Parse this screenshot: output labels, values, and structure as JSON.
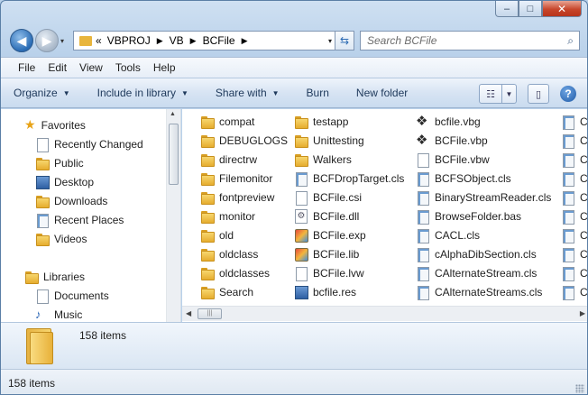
{
  "window": {
    "caption": {
      "minimize": "–",
      "maximize": "□",
      "close": "✕"
    }
  },
  "nav": {
    "back_icon": "◀",
    "forward_icon": "▶",
    "dropdown_icon": "▾",
    "address": {
      "overflow": "«",
      "crumbs": [
        "VBPROJ",
        "VB",
        "BCFile"
      ],
      "separator": "▶"
    },
    "refresh_icon": "⇆",
    "search": {
      "placeholder": "Search BCFile",
      "icon": "search-icon"
    }
  },
  "menu": {
    "items": [
      "File",
      "Edit",
      "View",
      "Tools",
      "Help"
    ]
  },
  "commands": {
    "organize": "Organize",
    "include_in_library": "Include in library",
    "share_with": "Share with",
    "burn": "Burn",
    "new_folder": "New folder",
    "dropdown_icon": "▼"
  },
  "navpane": {
    "favorites": {
      "title": "Favorites",
      "items": [
        "Recently Changed",
        "Public",
        "Desktop",
        "Downloads",
        "Recent Places",
        "Videos"
      ]
    },
    "libraries": {
      "title": "Libraries",
      "items": [
        "Documents",
        "Music"
      ]
    }
  },
  "files": {
    "col1": [
      "compat",
      "DEBUGLOGS",
      "directrw",
      "Filemonitor",
      "fontpreview",
      "monitor",
      "old",
      "oldclass",
      "oldclasses",
      "Search"
    ],
    "col2": [
      "testapp",
      "Unittesting",
      "Walkers",
      "BCFDropTarget.cls",
      "BCFile.csi",
      "BCFile.dll",
      "BCFile.exp",
      "BCFile.lib",
      "BCFile.lvw",
      "bcfile.res"
    ],
    "col3": [
      "bcfile.vbg",
      "BCFile.vbp",
      "BCFile.vbw",
      "BCFSObject.cls",
      "BinaryStreamReader.cls",
      "BrowseFolder.bas",
      "CACL.cls",
      "cAlphaDibSection.cls",
      "CAlternateStream.cls",
      "CAlternateStreams.cls"
    ],
    "col4": [
      "C",
      "C",
      "C",
      "C",
      "C",
      "C",
      "C",
      "C",
      "C",
      "C"
    ]
  },
  "details": {
    "count": "158 items"
  },
  "status": {
    "text": "158 items"
  }
}
